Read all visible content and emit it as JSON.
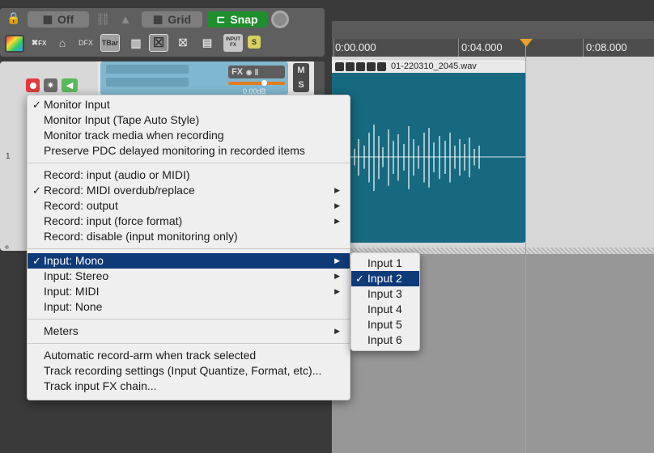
{
  "toolbar": {
    "off_label": "Off",
    "grid_label": "Grid",
    "snap_label": "Snap",
    "dfx_label": "DFX",
    "tbar_label": "TBar",
    "inputfx_label": "INPUT FX",
    "fx_small_label": "FX",
    "s_label": "S"
  },
  "track": {
    "number": "1",
    "fx_label": "FX",
    "volume_text": "0.00dB",
    "mute_label": "M",
    "solo_label": "S"
  },
  "ruler": {
    "labels": [
      "0:00.000",
      "0:04.000",
      "0:08.000"
    ]
  },
  "item": {
    "name": "01-220310_2045.wav"
  },
  "menu": {
    "groups": [
      {
        "items": [
          {
            "label": "Monitor Input",
            "checked": true
          },
          {
            "label": "Monitor Input (Tape Auto Style)"
          },
          {
            "label": "Monitor track media when recording"
          },
          {
            "label": "Preserve PDC delayed monitoring in recorded items"
          }
        ]
      },
      {
        "items": [
          {
            "label": "Record: input (audio or MIDI)"
          },
          {
            "label": "Record: MIDI overdub/replace",
            "checked": true,
            "submenu": true
          },
          {
            "label": "Record: output",
            "submenu": true
          },
          {
            "label": "Record: input (force format)",
            "submenu": true
          },
          {
            "label": "Record: disable (input monitoring only)"
          }
        ]
      },
      {
        "items": [
          {
            "label": "Input: Mono",
            "checked": true,
            "submenu": true,
            "highlighted": true
          },
          {
            "label": "Input: Stereo",
            "submenu": true
          },
          {
            "label": "Input: MIDI",
            "submenu": true
          },
          {
            "label": "Input: None"
          }
        ]
      },
      {
        "items": [
          {
            "label": "Meters",
            "submenu": true
          }
        ]
      },
      {
        "items": [
          {
            "label": "Automatic record-arm when track selected"
          },
          {
            "label": "Track recording settings (Input Quantize, Format, etc)..."
          },
          {
            "label": "Track input FX chain..."
          }
        ]
      }
    ]
  },
  "submenu": {
    "items": [
      {
        "label": "Input 1"
      },
      {
        "label": "Input 2",
        "checked": true,
        "highlighted": true
      },
      {
        "label": "Input 3"
      },
      {
        "label": "Input 4"
      },
      {
        "label": "Input 5"
      },
      {
        "label": "Input 6"
      }
    ]
  },
  "colors": {
    "accent": "#0f3a78",
    "snap_green": "#1e8f2d",
    "item_blue": "#16697f",
    "cursor_orange": "#e09a2a",
    "record_red": "#e23b3b"
  }
}
